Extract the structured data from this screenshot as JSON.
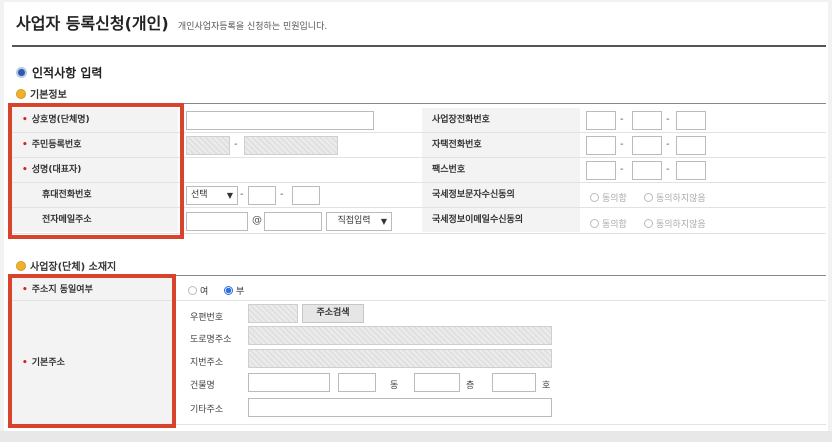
{
  "header": {
    "title": "사업자 등록신청(개인)",
    "subtitle": "개인사업자등록을 신청하는 민원입니다."
  },
  "section": {
    "title": "인적사항 입력"
  },
  "basic": {
    "heading": "기본정보",
    "left_rows": [
      {
        "label": "상호명(단체명)",
        "required": true
      },
      {
        "label": "주민등록번호",
        "required": true
      },
      {
        "label": "성명(대표자)",
        "required": true
      },
      {
        "label": "휴대전화번호",
        "required": false
      },
      {
        "label": "전자메일주소",
        "required": false
      }
    ],
    "right_rows": [
      {
        "label": "사업장전화번호"
      },
      {
        "label": "자택전화번호"
      },
      {
        "label": "팩스번호"
      },
      {
        "label": "국세정보문자수신동의"
      },
      {
        "label": "국세정보이메일수신동의"
      }
    ],
    "mobile_select": "선택",
    "email_at": "@",
    "email_select": "직접입력",
    "consent_yes": "동의함",
    "consent_no": "동의하지않음",
    "dash": "-"
  },
  "location": {
    "heading": "사업장(단체) 소재지",
    "same_label": "주소지 동일여부",
    "yes": "여",
    "no": "부",
    "basic_label": "기본주소",
    "postcode_label": "우편번호",
    "search_button": "주소검색",
    "road_label": "도로명주소",
    "jibun_label": "지번주소",
    "building_label": "건물명",
    "dong_unit": "동",
    "floor_unit": "층",
    "ho_unit": "호",
    "other_label": "기타주소"
  },
  "colors": {
    "highlight": "#d8432e",
    "required_star": "#d62020",
    "section_dot": "#2b5aa8",
    "sub_dot": "#f0b030"
  }
}
